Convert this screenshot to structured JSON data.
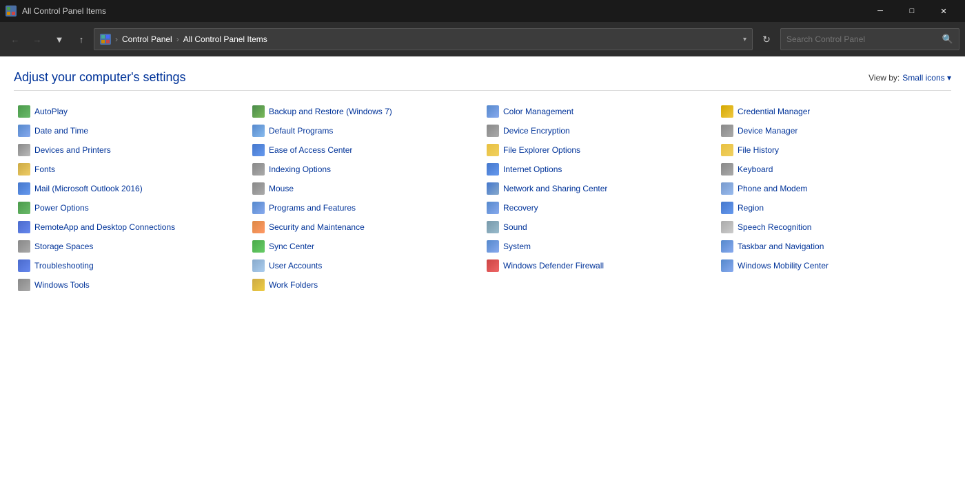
{
  "titlebar": {
    "title": "All Control Panel Items",
    "minimize": "─",
    "maximize": "□",
    "close": "✕"
  },
  "navbar": {
    "back_tooltip": "Back",
    "forward_tooltip": "Forward",
    "recent_tooltip": "Recent locations",
    "up_tooltip": "Up",
    "address": {
      "icon_label": "CP",
      "path1": "Control Panel",
      "sep1": ">",
      "path2": "All Control Panel Items"
    },
    "search_placeholder": "Search Control Panel",
    "refresh_symbol": "↻",
    "dropdown_symbol": "▾"
  },
  "main": {
    "title": "Adjust your computer's settings",
    "view_by_label": "View by:",
    "view_by_value": "Small icons",
    "view_by_arrow": "▾",
    "items": [
      {
        "col": 0,
        "label": "AutoPlay",
        "icon": "autoplay"
      },
      {
        "col": 1,
        "label": "Backup and Restore (Windows 7)",
        "icon": "backup"
      },
      {
        "col": 2,
        "label": "Color Management",
        "icon": "color"
      },
      {
        "col": 3,
        "label": "Credential Manager",
        "icon": "credential"
      },
      {
        "col": 0,
        "label": "Date and Time",
        "icon": "datetime"
      },
      {
        "col": 1,
        "label": "Default Programs",
        "icon": "default"
      },
      {
        "col": 2,
        "label": "Device Encryption",
        "icon": "deviceenc"
      },
      {
        "col": 3,
        "label": "Device Manager",
        "icon": "devmgr"
      },
      {
        "col": 0,
        "label": "Devices and Printers",
        "icon": "devices"
      },
      {
        "col": 1,
        "label": "Ease of Access Center",
        "icon": "ease"
      },
      {
        "col": 2,
        "label": "File Explorer Options",
        "icon": "fileexp"
      },
      {
        "col": 3,
        "label": "File History",
        "icon": "filehistory"
      },
      {
        "col": 0,
        "label": "Fonts",
        "icon": "fonts"
      },
      {
        "col": 1,
        "label": "Indexing Options",
        "icon": "indexing"
      },
      {
        "col": 2,
        "label": "Internet Options",
        "icon": "internet"
      },
      {
        "col": 3,
        "label": "Keyboard",
        "icon": "keyboard"
      },
      {
        "col": 0,
        "label": "Mail (Microsoft Outlook 2016)",
        "icon": "mail"
      },
      {
        "col": 1,
        "label": "Mouse",
        "icon": "mouse"
      },
      {
        "col": 2,
        "label": "Network and Sharing Center",
        "icon": "network"
      },
      {
        "col": 3,
        "label": "Phone and Modem",
        "icon": "phone"
      },
      {
        "col": 0,
        "label": "Power Options",
        "icon": "power"
      },
      {
        "col": 1,
        "label": "Programs and Features",
        "icon": "programs"
      },
      {
        "col": 2,
        "label": "Recovery",
        "icon": "recovery"
      },
      {
        "col": 3,
        "label": "Region",
        "icon": "region"
      },
      {
        "col": 0,
        "label": "RemoteApp and Desktop Connections",
        "icon": "remote"
      },
      {
        "col": 1,
        "label": "Security and Maintenance",
        "icon": "security"
      },
      {
        "col": 2,
        "label": "Sound",
        "icon": "sound"
      },
      {
        "col": 3,
        "label": "Speech Recognition",
        "icon": "speech"
      },
      {
        "col": 0,
        "label": "Storage Spaces",
        "icon": "storage"
      },
      {
        "col": 1,
        "label": "Sync Center",
        "icon": "sync"
      },
      {
        "col": 2,
        "label": "System",
        "icon": "system"
      },
      {
        "col": 3,
        "label": "Taskbar and Navigation",
        "icon": "taskbar"
      },
      {
        "col": 0,
        "label": "Troubleshooting",
        "icon": "trouble"
      },
      {
        "col": 1,
        "label": "User Accounts",
        "icon": "user"
      },
      {
        "col": 2,
        "label": "Windows Defender Firewall",
        "icon": "windefender"
      },
      {
        "col": 3,
        "label": "Windows Mobility Center",
        "icon": "winmobility"
      },
      {
        "col": 0,
        "label": "Windows Tools",
        "icon": "wintools"
      },
      {
        "col": 1,
        "label": "Work Folders",
        "icon": "work"
      }
    ]
  }
}
